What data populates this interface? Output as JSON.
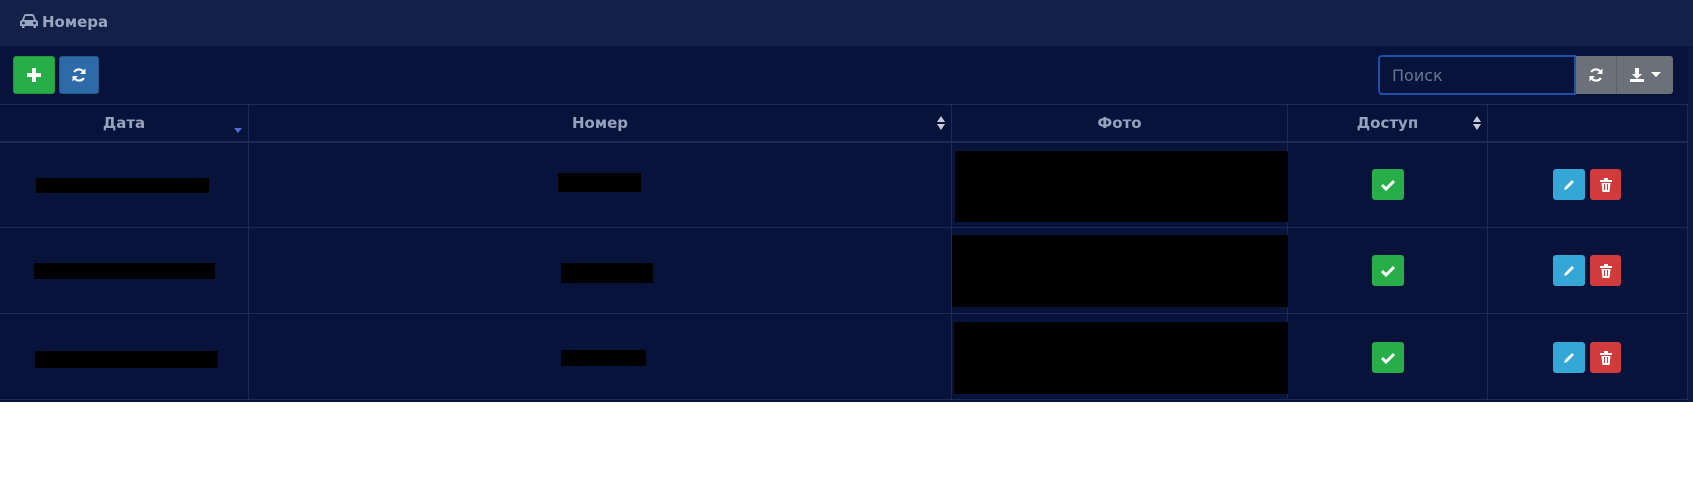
{
  "header": {
    "title": "Номера",
    "icon": "car-icon"
  },
  "toolbar": {
    "add_icon": "plus-icon",
    "refresh_icon": "refresh-icon",
    "export_icon": "download-icon"
  },
  "search": {
    "placeholder": "Поиск",
    "value": ""
  },
  "table": {
    "columns": [
      {
        "label": "Дата",
        "sort": "desc"
      },
      {
        "label": "Номер",
        "sort": "both"
      },
      {
        "label": "Фото",
        "sort": "none"
      },
      {
        "label": "Доступ",
        "sort": "both"
      },
      {
        "label": "",
        "sort": "none"
      }
    ],
    "rows": [
      {
        "access": true
      },
      {
        "access": true
      },
      {
        "access": true
      }
    ]
  },
  "colors": {
    "panel_bg": "#08133c",
    "heading_bg": "#132149",
    "success": "#27ae48",
    "primary": "#2d6aa8",
    "info": "#34a7d6",
    "danger": "#d13b3b",
    "default": "#6b7079"
  }
}
